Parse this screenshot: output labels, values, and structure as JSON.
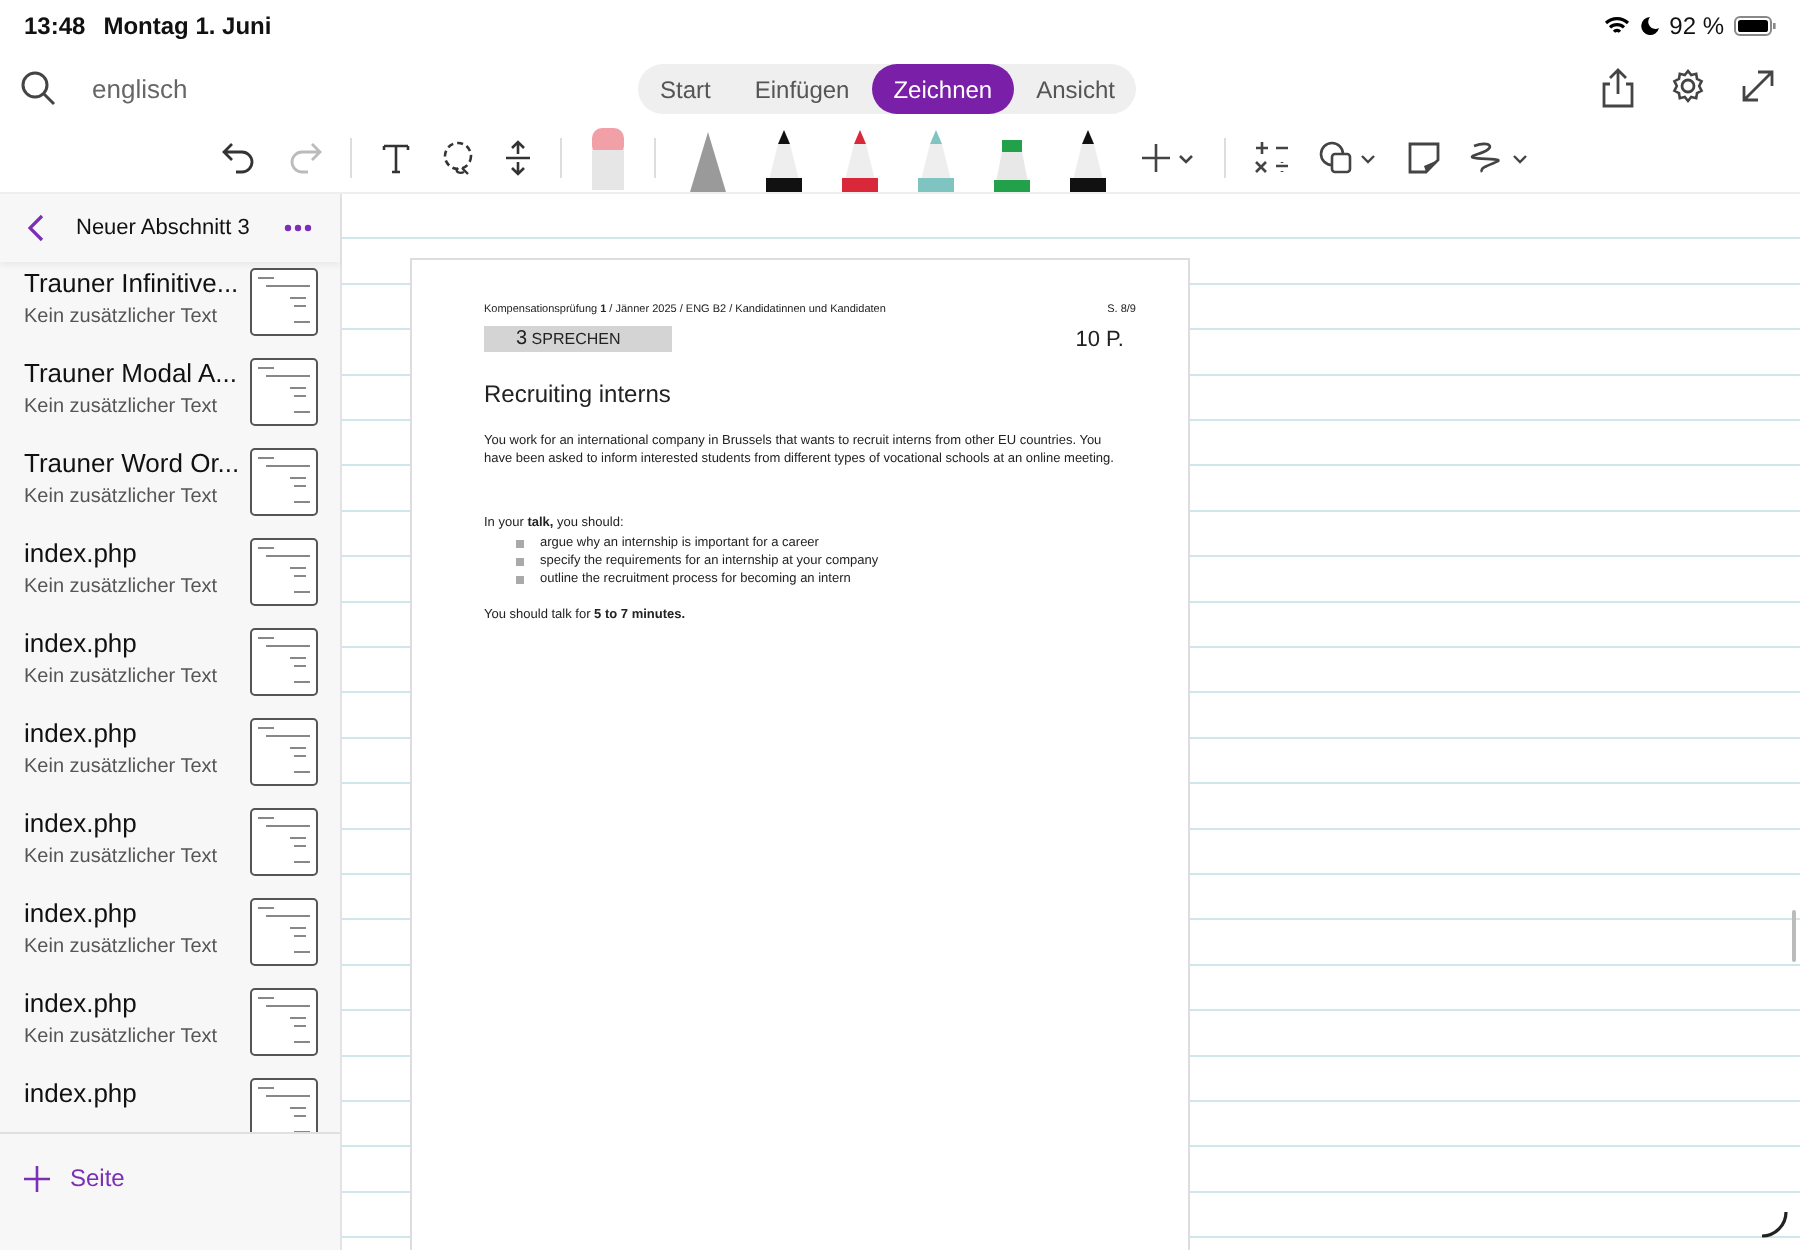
{
  "status_bar": {
    "time": "13:48",
    "date": "Montag 1. Juni",
    "battery": "92 %"
  },
  "search": {
    "value": "englisch"
  },
  "tabs": [
    {
      "label": "Start",
      "selected": false
    },
    {
      "label": "Einfügen",
      "selected": false
    },
    {
      "label": "Zeichnen",
      "selected": true
    },
    {
      "label": "Ansicht",
      "selected": false
    }
  ],
  "pens": [
    {
      "kind": "pencil",
      "color": "#9a9a9a",
      "selected": false
    },
    {
      "kind": "pen",
      "color": "#111111",
      "selected": false
    },
    {
      "kind": "pen",
      "color": "#d8283a",
      "selected": false
    },
    {
      "kind": "pen",
      "color": "#7fc4c0",
      "selected": false
    },
    {
      "kind": "highlighter",
      "color": "#22a04a",
      "selected": false
    },
    {
      "kind": "pen",
      "color": "#111111",
      "selected": false
    }
  ],
  "sidebar": {
    "section_title": "Neuer Abschnitt 3",
    "pages": [
      {
        "title": "Trauner Infinitive...",
        "subtitle": "Kein zusätzlicher Text"
      },
      {
        "title": "Trauner Modal A...",
        "subtitle": "Kein zusätzlicher Text"
      },
      {
        "title": "Trauner Word Or...",
        "subtitle": "Kein zusätzlicher Text"
      },
      {
        "title": "index.php",
        "subtitle": "Kein zusätzlicher Text"
      },
      {
        "title": "index.php",
        "subtitle": "Kein zusätzlicher Text"
      },
      {
        "title": "index.php",
        "subtitle": "Kein zusätzlicher Text"
      },
      {
        "title": "index.php",
        "subtitle": "Kein zusätzlicher Text"
      },
      {
        "title": "index.php",
        "subtitle": "Kein zusätzlicher Text"
      },
      {
        "title": "index.php",
        "subtitle": "Kein zusätzlicher Text"
      },
      {
        "title": "index.php"
      }
    ],
    "add_page": "Seite"
  },
  "document": {
    "header": "Kompensationsprüfung **1** / Jänner 2025 / ENG B2 / Kandidatinnen und Kandidaten",
    "page_number": "S. 8/9",
    "section_number": "3",
    "section_label": "SPRECHEN",
    "points": "10 P.",
    "heading": "Recruiting interns",
    "intro": "You work for an international company in Brussels that wants to recruit interns from other EU countries. You have been asked to inform interested students from different types of vocational schools at an online meeting.",
    "prompt": "In your **talk,** you should:",
    "bullets": [
      "argue why an internship is important for a career",
      "specify the requirements for an internship at your company",
      "outline the recruitment process for becoming an intern"
    ],
    "closing": "You should talk for **5 to 7 minutes.**"
  }
}
